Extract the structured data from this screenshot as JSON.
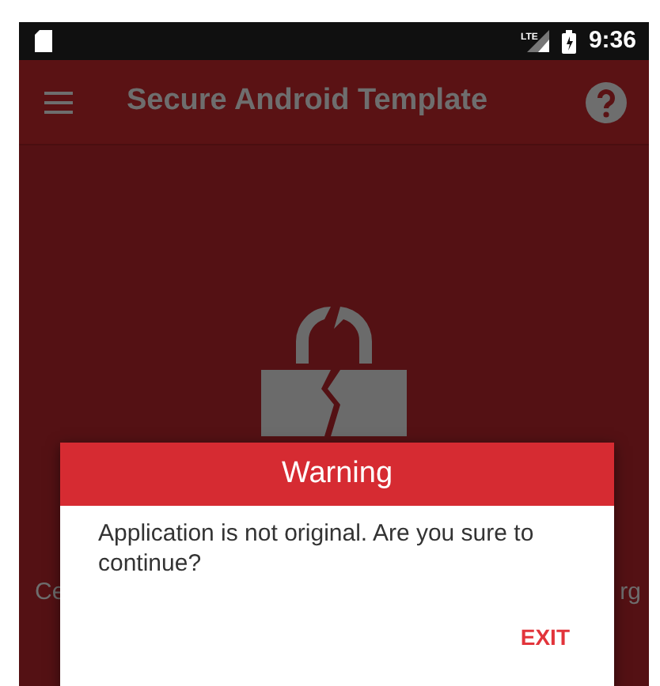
{
  "status_bar": {
    "time": "9:36",
    "network_label": "LTE"
  },
  "toolbar": {
    "title": "Secure Android Template"
  },
  "background_text": {
    "left": "Ce",
    "right": "rg"
  },
  "dialog": {
    "title": "Warning",
    "message": "Application is not original. Are you sure to continue?",
    "buttons": [
      "EXIT"
    ]
  }
}
